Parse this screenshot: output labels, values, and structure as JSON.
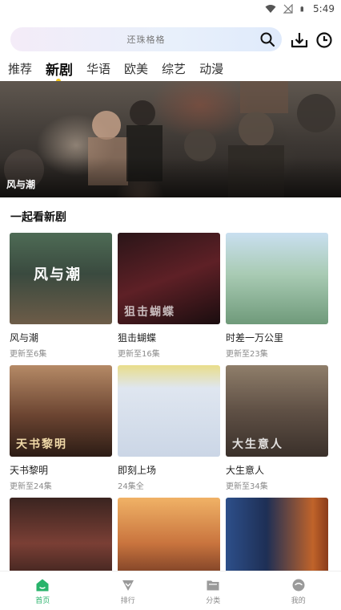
{
  "status_bar": {
    "time": "5:49"
  },
  "search": {
    "placeholder": "还珠格格"
  },
  "tabs": [
    {
      "label": "推荐"
    },
    {
      "label": "新剧"
    },
    {
      "label": "华语"
    },
    {
      "label": "欧美"
    },
    {
      "label": "综艺"
    },
    {
      "label": "动漫"
    }
  ],
  "active_tab": "新剧",
  "banner": {
    "title": "风与潮"
  },
  "section": {
    "title": "一起看新剧"
  },
  "cards": [
    {
      "title": "风与潮",
      "subtitle": "更新至6集",
      "poster_text": "风与潮"
    },
    {
      "title": "狙击蝴蝶",
      "subtitle": "更新至16集",
      "poster_text": "狙击蝴蝶"
    },
    {
      "title": "时差一万公里",
      "subtitle": "更新至23集",
      "poster_text": ""
    },
    {
      "title": "天书黎明",
      "subtitle": "更新至24集",
      "poster_text": "天书黎明"
    },
    {
      "title": "即刻上场",
      "subtitle": "24集全",
      "poster_text": ""
    },
    {
      "title": "大生意人",
      "subtitle": "更新至34集",
      "poster_text": "大生意人"
    },
    {
      "title": "",
      "subtitle": "",
      "poster_text": ""
    },
    {
      "title": "",
      "subtitle": "",
      "poster_text": ""
    },
    {
      "title": "",
      "subtitle": "",
      "poster_text": ""
    }
  ],
  "bottom_nav": [
    {
      "label": "首页",
      "icon": "home-icon"
    },
    {
      "label": "排行",
      "icon": "ranking-icon"
    },
    {
      "label": "分类",
      "icon": "folder-icon"
    },
    {
      "label": "我的",
      "icon": "profile-icon"
    }
  ],
  "colors": {
    "accent": "#29b36b",
    "tab_indicator": "#f3c51b"
  }
}
